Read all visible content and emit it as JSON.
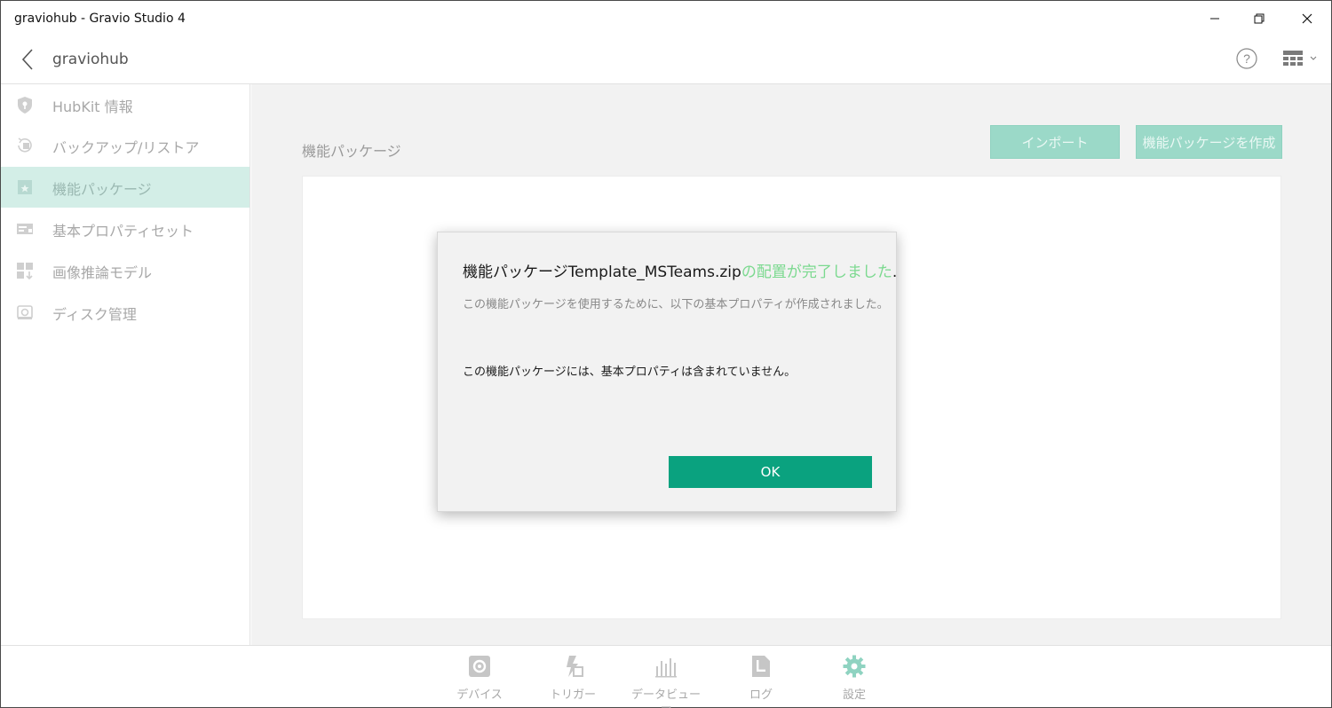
{
  "window": {
    "title": "graviohub - Gravio Studio 4"
  },
  "header": {
    "hub_name": "graviohub"
  },
  "sidebar": {
    "items": [
      {
        "label": "HubKit 情報",
        "icon": "shield-key-icon",
        "active": false
      },
      {
        "label": "バックアップ/リストア",
        "icon": "backup-restore-icon",
        "active": false
      },
      {
        "label": "機能パッケージ",
        "icon": "package-star-icon",
        "active": true
      },
      {
        "label": "基本プロパティセット",
        "icon": "property-set-icon",
        "active": false
      },
      {
        "label": "画像推論モデル",
        "icon": "model-grid-icon",
        "active": false
      },
      {
        "label": "ディスク管理",
        "icon": "disk-icon",
        "active": false
      }
    ]
  },
  "main": {
    "section_title": "機能パッケージ",
    "import_label": "インポート",
    "create_label": "機能パッケージを作成"
  },
  "dialog": {
    "title_file": "機能パッケージTemplate_MSTeams.zip",
    "title_done": "の配置が完了しました",
    "title_dot": ".",
    "subtitle": "この機能パッケージを使用するために、以下の基本プロパティが作成されました。",
    "message": "この機能パッケージには、基本プロパティは含まれていません。",
    "ok_label": "OK"
  },
  "bottom_nav": {
    "items": [
      {
        "label": "デバイス",
        "icon": "gear-box-icon"
      },
      {
        "label": "トリガー",
        "icon": "trigger-icon"
      },
      {
        "label": "データビューア",
        "icon": "bar-chart-icon"
      },
      {
        "label": "ログ",
        "icon": "log-document-icon"
      },
      {
        "label": "設定",
        "icon": "settings-gear-icon"
      }
    ]
  },
  "colors": {
    "accent": "#0aa27f",
    "accent_light": "#9bd9c8",
    "active_bg": "#d3eee7",
    "success_text": "#7bd98f"
  }
}
